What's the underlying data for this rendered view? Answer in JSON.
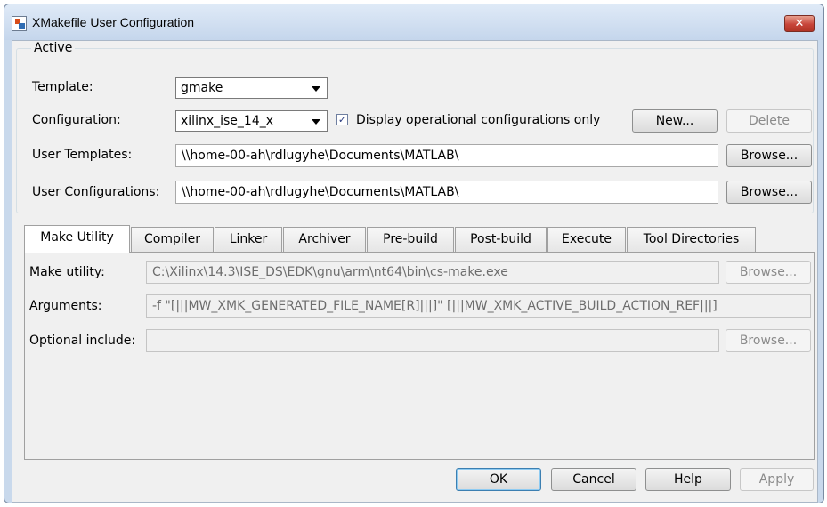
{
  "window": {
    "title": "XMakefile User Configuration",
    "close_glyph": "✕"
  },
  "active_group": {
    "legend": "Active",
    "template_label": "Template:",
    "template_value": "gmake",
    "configuration_label": "Configuration:",
    "configuration_value": "xilinx_ise_14_x",
    "display_operational_label": "Display operational configurations only",
    "display_operational_checked": true,
    "check_glyph": "✓",
    "new_button": "New...",
    "delete_button": "Delete",
    "user_templates_label": "User Templates:",
    "user_templates_value": "\\\\home-00-ah\\rdlugyhe\\Documents\\MATLAB\\",
    "user_templates_browse": "Browse...",
    "user_configurations_label": "User Configurations:",
    "user_configurations_value": "\\\\home-00-ah\\rdlugyhe\\Documents\\MATLAB\\",
    "user_configurations_browse": "Browse..."
  },
  "tabs": [
    {
      "label": "Make Utility",
      "selected": true
    },
    {
      "label": "Compiler"
    },
    {
      "label": "Linker"
    },
    {
      "label": "Archiver"
    },
    {
      "label": "Pre-build"
    },
    {
      "label": "Post-build"
    },
    {
      "label": "Execute"
    },
    {
      "label": "Tool Directories"
    }
  ],
  "make_utility": {
    "make_utility_label": "Make utility:",
    "make_utility_value": "C:\\Xilinx\\14.3\\ISE_DS\\EDK\\gnu\\arm\\nt64\\bin\\cs-make.exe",
    "make_utility_browse": "Browse...",
    "arguments_label": "Arguments:",
    "arguments_value": "-f \"[|||MW_XMK_GENERATED_FILE_NAME[R]|||]\" [|||MW_XMK_ACTIVE_BUILD_ACTION_REF|||]",
    "optional_include_label": "Optional include:",
    "optional_include_value": "",
    "optional_include_browse": "Browse..."
  },
  "footer": {
    "ok": "OK",
    "cancel": "Cancel",
    "help": "Help",
    "apply": "Apply"
  },
  "colors": {
    "title_bar": "#c5d6ec",
    "close_button": "#c7453a",
    "dialog_bg": "#f0f0f0"
  }
}
